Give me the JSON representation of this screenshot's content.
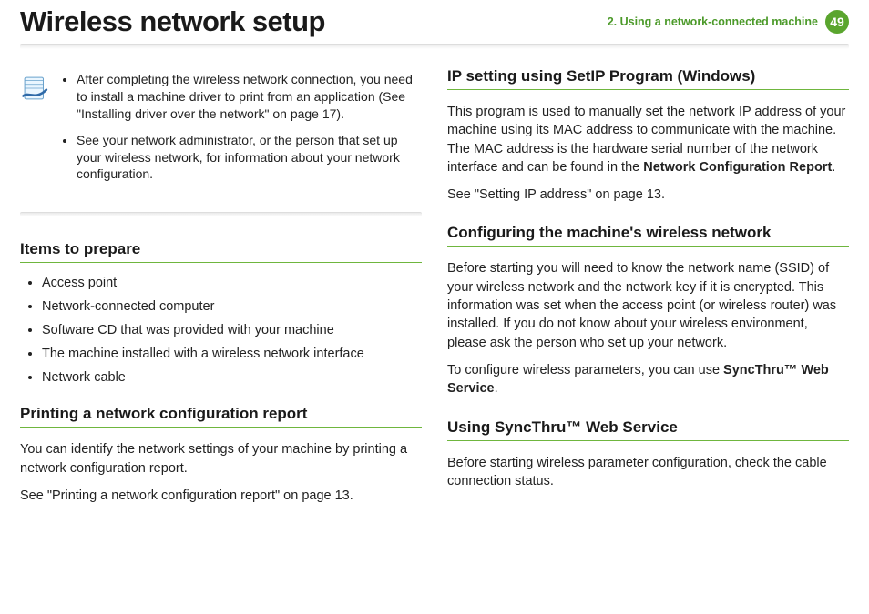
{
  "header": {
    "title": "Wireless network setup",
    "chapter": "2.  Using a network-connected machine",
    "page_number": "49"
  },
  "left": {
    "note": {
      "icon": "note-page-icon",
      "bullets": [
        "After completing the wireless network connection, you need to install a machine driver to print from an application (See \"Installing driver over the network\" on page 17).",
        "See your network administrator, or the person that set up your wireless network, for information about your network configuration."
      ]
    },
    "items_heading": "Items to prepare",
    "items": [
      "Access point",
      "Network-connected computer",
      "Software CD that was provided with your machine",
      "The machine installed with a wireless network interface",
      "Network cable"
    ],
    "print_heading": "Printing a network configuration report",
    "print_p1": "You can identify the network settings of your machine by printing a network configuration report.",
    "print_p2": "See \"Printing a network configuration report\" on page 13."
  },
  "right": {
    "ip_heading": "IP setting using SetIP Program (Windows)",
    "ip_p1_pre": "This program is used to manually set the network IP address of your machine using its MAC address to communicate with the machine. The MAC address is the hardware serial number of the network interface and can be found in the ",
    "ip_bold": "Network Configuration Report",
    "ip_p1_post": ".",
    "ip_p2": "See \"Setting IP address\" on page 13.",
    "cfg_heading": "Configuring the machine's wireless network",
    "cfg_p1": "Before starting you will need to know the network name (SSID) of your wireless network and the network key if it is encrypted. This information was set when the access point (or wireless router) was installed. If you do not know about your wireless environment, please ask the person who set up your network.",
    "cfg_p2_pre": "To configure wireless parameters, you can use ",
    "cfg_bold": "SyncThru™ Web Service",
    "cfg_p2_post": ".",
    "sync_heading": "Using SyncThru™ Web Service",
    "sync_p1": "Before starting wireless parameter configuration, check the cable connection status."
  }
}
